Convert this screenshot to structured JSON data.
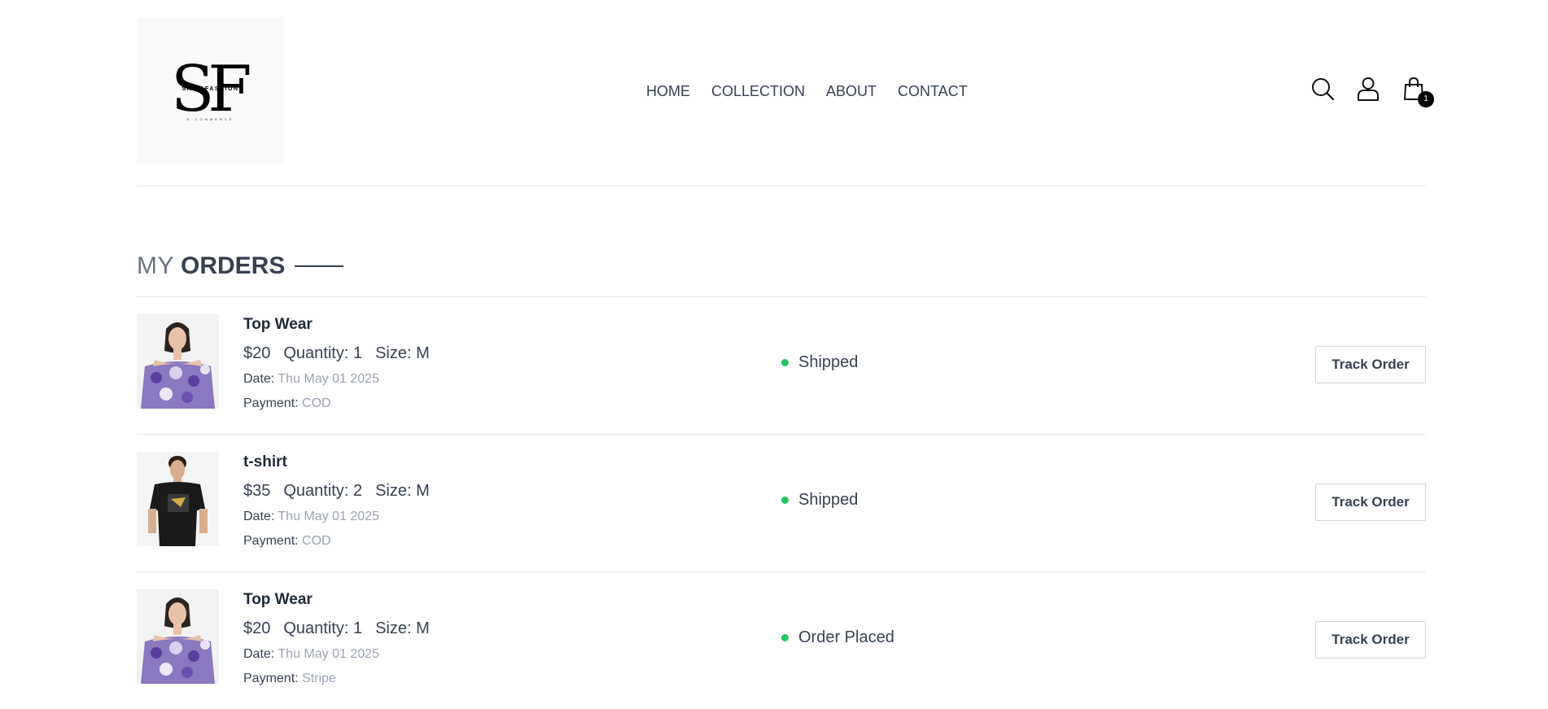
{
  "logo": {
    "letters": "SF",
    "name": "SHIVAFASHION",
    "tagline": "E-COMMERCE"
  },
  "nav": [
    {
      "label": "HOME"
    },
    {
      "label": "COLLECTION"
    },
    {
      "label": "ABOUT"
    },
    {
      "label": "CONTACT"
    }
  ],
  "icons": {
    "search": "search-icon",
    "profile": "profile-icon",
    "cart": "cart-icon"
  },
  "cart_count": "1",
  "page_title": {
    "part1": "MY",
    "part2": "ORDERS"
  },
  "orders": [
    {
      "name": "Top Wear",
      "price": "$20",
      "quantity": "Quantity: 1",
      "size": "Size: M",
      "date_label": "Date:",
      "date": "Thu May 01 2025",
      "payment_label": "Payment:",
      "payment": "COD",
      "status": "Shipped",
      "track_label": "Track Order"
    },
    {
      "name": "t-shirt",
      "price": "$35",
      "quantity": "Quantity: 2",
      "size": "Size: M",
      "date_label": "Date:",
      "date": "Thu May 01 2025",
      "payment_label": "Payment:",
      "payment": "COD",
      "status": "Shipped",
      "track_label": "Track Order"
    },
    {
      "name": "Top Wear",
      "price": "$20",
      "quantity": "Quantity: 1",
      "size": "Size: M",
      "date_label": "Date:",
      "date": "Thu May 01 2025",
      "payment_label": "Payment:",
      "payment": "Stripe",
      "status": "Order Placed",
      "track_label": "Track Order"
    }
  ],
  "colors": {
    "status_dot": "#22c55e",
    "text": "#374151",
    "muted": "#9ca3af"
  }
}
